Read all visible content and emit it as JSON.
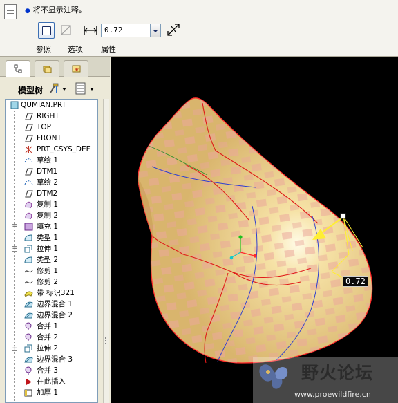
{
  "dashboard": {
    "message": "将不显示注释。",
    "thickness_value": "0.72",
    "tabs": [
      "参照",
      "选项",
      "属性"
    ]
  },
  "left_panel": {
    "model_tree_title": "模型树",
    "tree_items": [
      {
        "label": "QUMIAN.PRT",
        "icon": "part-icon"
      },
      {
        "label": "RIGHT",
        "icon": "datum-plane-icon"
      },
      {
        "label": "TOP",
        "icon": "datum-plane-icon"
      },
      {
        "label": "FRONT",
        "icon": "datum-plane-icon"
      },
      {
        "label": "PRT_CSYS_DEF",
        "icon": "csys-icon"
      },
      {
        "label": "草绘 1",
        "icon": "sketch-icon"
      },
      {
        "label": "DTM1",
        "icon": "datum-plane-icon"
      },
      {
        "label": "草绘 2",
        "icon": "sketch-icon"
      },
      {
        "label": "DTM2",
        "icon": "datum-plane-icon"
      },
      {
        "label": "复制 1",
        "icon": "copy-icon"
      },
      {
        "label": "复制 2",
        "icon": "copy-icon"
      },
      {
        "label": "填充 1",
        "icon": "fill-icon",
        "expandable": true
      },
      {
        "label": "类型 1",
        "icon": "surface-icon"
      },
      {
        "label": "拉伸 1",
        "icon": "extrude-icon",
        "expandable": true
      },
      {
        "label": "类型 2",
        "icon": "surface-icon"
      },
      {
        "label": "修剪 1",
        "icon": "trim-icon"
      },
      {
        "label": "修剪 2",
        "icon": "trim-icon"
      },
      {
        "label": "带 标识321",
        "icon": "band-icon"
      },
      {
        "label": "边界混合 1",
        "icon": "boundary-blend-icon"
      },
      {
        "label": "边界混合 2",
        "icon": "boundary-blend-icon"
      },
      {
        "label": "合并 1",
        "icon": "merge-icon"
      },
      {
        "label": "合并 2",
        "icon": "merge-icon"
      },
      {
        "label": "拉伸 2",
        "icon": "extrude-icon",
        "expandable": true
      },
      {
        "label": "边界混合 3",
        "icon": "boundary-blend-icon"
      },
      {
        "label": "合并 3",
        "icon": "merge-icon"
      },
      {
        "label": "在此插入",
        "icon": "insert-here-icon"
      },
      {
        "label": "加厚 1",
        "icon": "thicken-icon"
      }
    ]
  },
  "graphics": {
    "dimension_label": "0.72",
    "watermark_title": "野火论坛",
    "watermark_url": "www.proewildfire.cn"
  },
  "colors": {
    "model_fill": "#e8c98a",
    "model_stripe": "#e9a89a",
    "model_edge": "#ff2a2a",
    "arrow": "#ffee33",
    "background": "#000000"
  }
}
